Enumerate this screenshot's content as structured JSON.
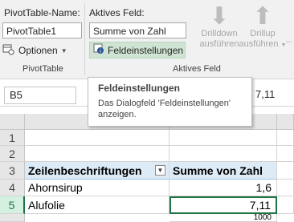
{
  "ribbon": {
    "pivottable_name_label": "PivotTable-Name:",
    "pivottable_name_value": "PivotTable1",
    "options_button": "Optionen",
    "pivottable_group": "PivotTable",
    "active_field_label": "Aktives Feld:",
    "active_field_value": "Summe von Zahl",
    "field_settings_button": "Feldeinstellungen",
    "active_field_group": "Aktives Feld",
    "drilldown_line1": "Drilldown",
    "drilldown_line2": "ausführen",
    "drillup_line1": "Drillup",
    "drillup_line2": "ausführen"
  },
  "formula_bar": {
    "name_box": "B5",
    "value": "7,11"
  },
  "tooltip": {
    "title": "Feldeinstellungen",
    "description": "Das Dialogfeld 'Feldeinstellungen' anzeigen."
  },
  "sheet": {
    "row_numbers": [
      "1",
      "2",
      "3",
      "4",
      "5"
    ],
    "header_col_a": "Zeilenbeschriftungen",
    "header_col_b": "Summe von Zahl",
    "rows": [
      {
        "label": "Ahornsirup",
        "value": "1,6"
      },
      {
        "label": "Alufolie",
        "value": "7,11"
      }
    ],
    "partial_next_value": "1000"
  },
  "colors": {
    "ribbon_bg": "#f1f1f1",
    "accent_green": "#217346",
    "pivot_header_bg": "#ddebf7"
  }
}
